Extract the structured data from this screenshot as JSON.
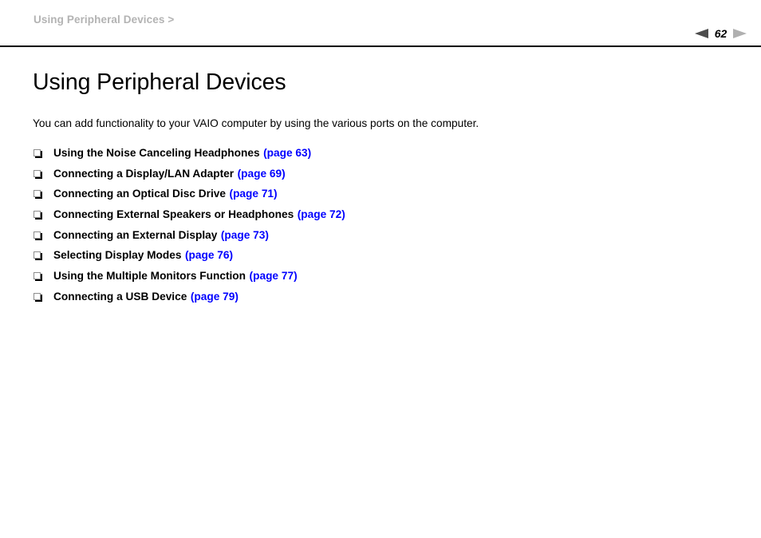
{
  "header": {
    "breadcrumb": "Using Peripheral Devices >",
    "pager": {
      "prev_icon": "triangle-left-icon",
      "next_icon": "triangle-right-icon",
      "page_number": "62"
    }
  },
  "main": {
    "title": "Using Peripheral Devices",
    "intro": "You can add functionality to your VAIO computer by using the various ports on the computer.",
    "links": [
      {
        "bullet_icon": "bullet-square-icon",
        "label": "Using the Noise Canceling Headphones",
        "ref": "(page 63)"
      },
      {
        "bullet_icon": "bullet-square-icon",
        "label": "Connecting a Display/LAN Adapter",
        "ref": "(page 69)"
      },
      {
        "bullet_icon": "bullet-square-icon",
        "label": "Connecting an Optical Disc Drive",
        "ref": "(page 71)"
      },
      {
        "bullet_icon": "bullet-square-icon",
        "label": "Connecting External Speakers or Headphones",
        "ref": "(page 72)"
      },
      {
        "bullet_icon": "bullet-square-icon",
        "label": "Connecting an External Display",
        "ref": "(page 73)"
      },
      {
        "bullet_icon": "bullet-square-icon",
        "label": "Selecting Display Modes",
        "ref": "(page 76)"
      },
      {
        "bullet_icon": "bullet-square-icon",
        "label": "Using the Multiple Monitors Function",
        "ref": "(page 77)"
      },
      {
        "bullet_icon": "bullet-square-icon",
        "label": "Connecting a USB Device",
        "ref": "(page 79)"
      }
    ]
  },
  "colors": {
    "link": "#0000ff",
    "breadcrumb": "#b3b3b3",
    "rule": "#000000",
    "prev_arrow": "#4d4d4d",
    "next_arrow": "#b0b0b0"
  }
}
